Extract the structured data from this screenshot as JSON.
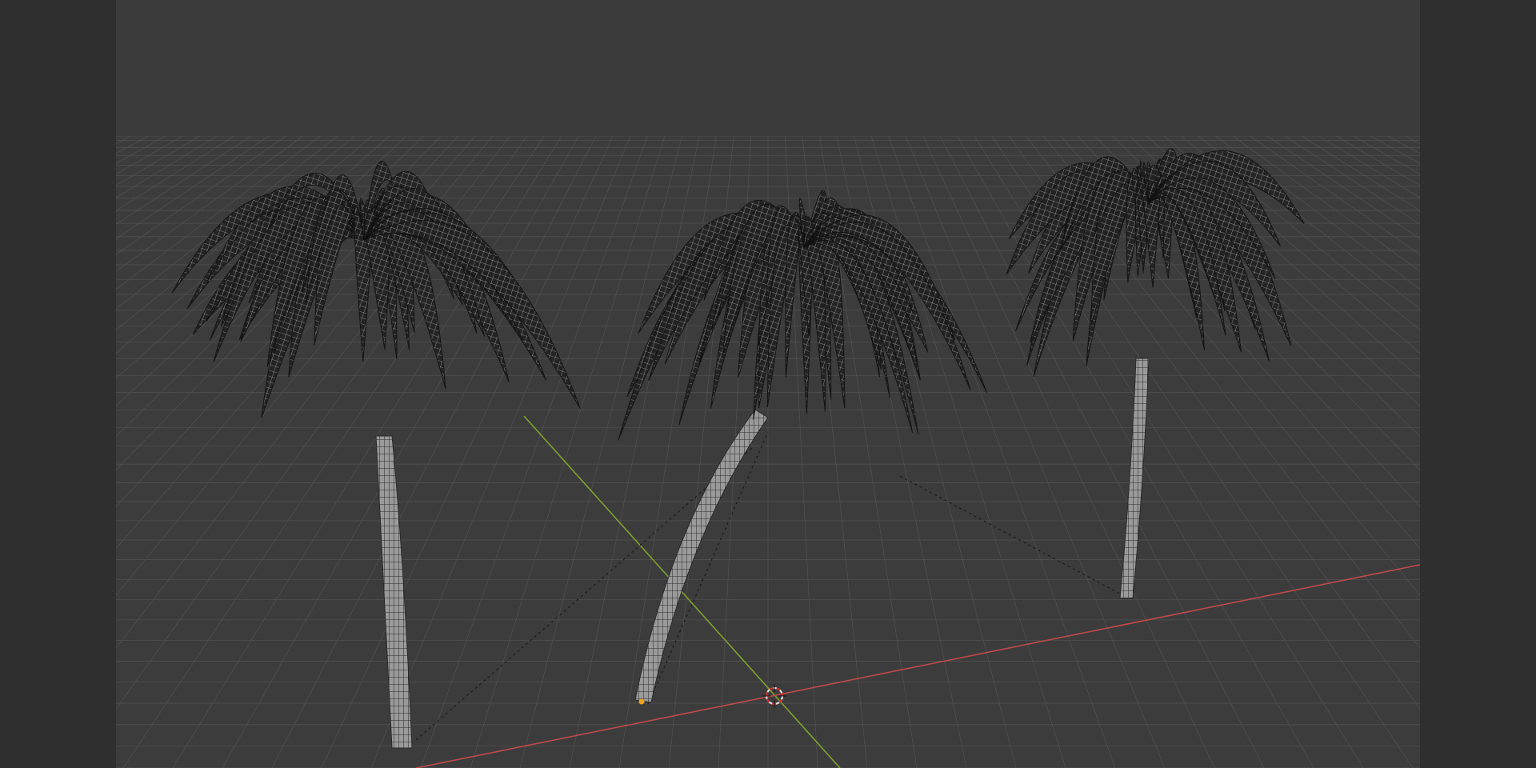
{
  "viewport": {
    "mode": "wireframe",
    "background": "#3b3b3b",
    "grid_color": "#505050",
    "x_axis_color": "#c24a4a",
    "y_axis_color": "#7ea22e",
    "wire_color": "#b8b8b8",
    "foliage_fill": "#1e1e1e",
    "parent_line_color": "#1a1a1a"
  },
  "scene": {
    "objects": [
      {
        "name": "palm-tree-left",
        "type": "mesh",
        "selected": false
      },
      {
        "name": "palm-tree-center",
        "type": "mesh",
        "selected": false,
        "origin_color": "#f0a020"
      },
      {
        "name": "palm-tree-right",
        "type": "mesh",
        "selected": false
      }
    ],
    "cursor_3d": {
      "icon": "3d-cursor-icon",
      "ring_colors": [
        "#e0e0e0",
        "#d03030"
      ]
    }
  }
}
